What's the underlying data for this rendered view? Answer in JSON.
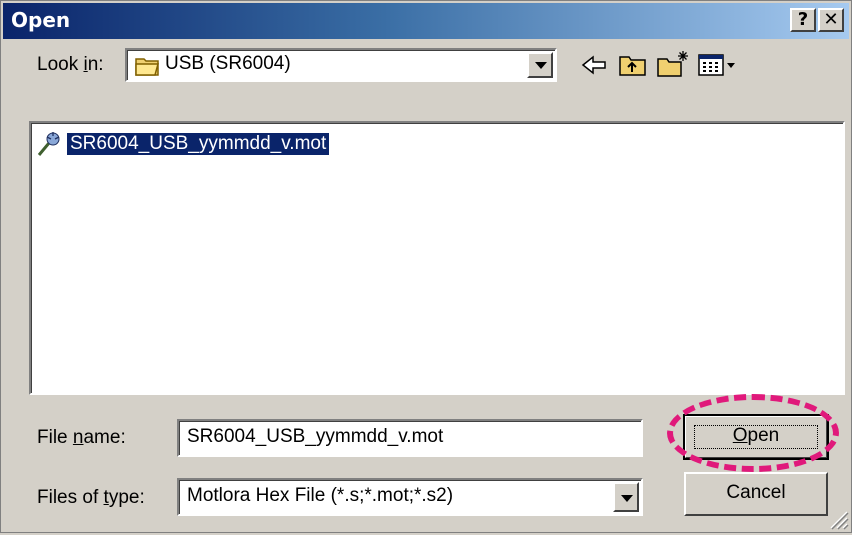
{
  "window": {
    "title": "Open",
    "help_glyph": "?",
    "close_glyph": "✕"
  },
  "look_in": {
    "label_pre": "Look ",
    "label_mnemonic": "i",
    "label_post": "n:",
    "value": "USB (SR6004)",
    "folder_icon": "folder-icon"
  },
  "toolbar": {
    "back_icon": "back-arrow-icon",
    "up_icon": "up-folder-icon",
    "new_folder_icon": "new-folder-icon",
    "view_icon": "view-menu-icon"
  },
  "files": [
    {
      "name": "SR6004_USB_yymmdd_v.mot",
      "icon": "file-icon",
      "selected": true
    }
  ],
  "file_name": {
    "label_pre": "File ",
    "label_mnemonic": "n",
    "label_post": "ame:",
    "value": "SR6004_USB_yymmdd_v.mot"
  },
  "file_type": {
    "label_pre": "Files of ",
    "label_mnemonic": "t",
    "label_post": "ype:",
    "value": "Motlora Hex File (*.s;*.mot;*.s2)"
  },
  "buttons": {
    "open_mnemonic": "O",
    "open_rest": "pen",
    "cancel": "Cancel"
  },
  "colors": {
    "title_start": "#0a246a",
    "title_end": "#a6caf0",
    "face": "#d4d0c8",
    "selection": "#0a246a",
    "highlight_ring": "#e0197b"
  }
}
